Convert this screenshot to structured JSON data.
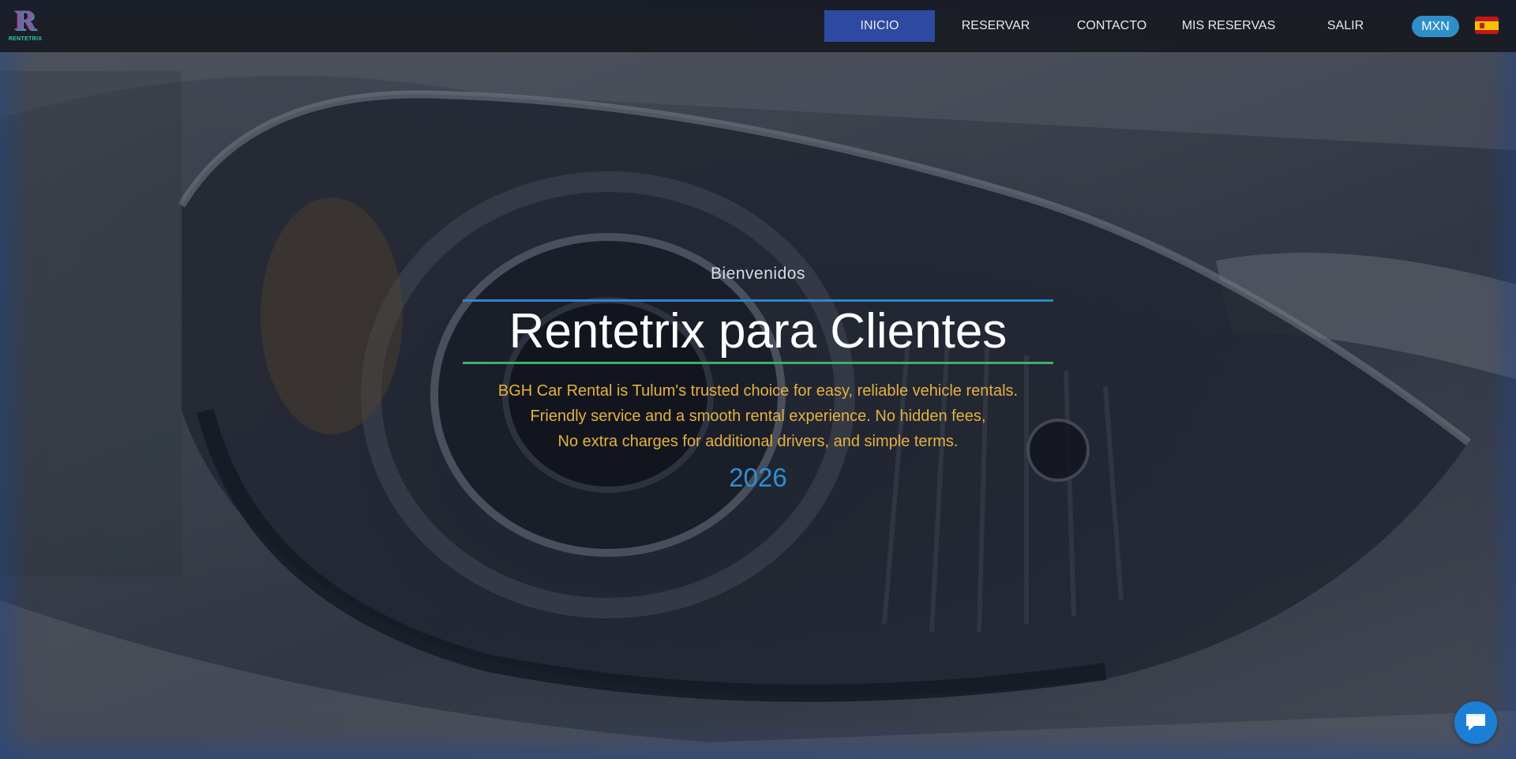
{
  "brand": {
    "logo_letter": "R",
    "logo_text": "RENTETRIX"
  },
  "nav": {
    "items": [
      {
        "label": "INICIO",
        "active": true
      },
      {
        "label": "RESERVAR",
        "active": false
      },
      {
        "label": "CONTACTO",
        "active": false
      },
      {
        "label": "MIS RESERVAS",
        "active": false
      },
      {
        "label": "SALIR",
        "active": false
      }
    ],
    "currency": "MXN",
    "language_icon": "spain-flag-icon"
  },
  "hero": {
    "welcome": "Bienvenidos",
    "title": "Rentetrix para Clientes",
    "description_lines": [
      "BGH Car Rental is Tulum's trusted choice for easy, reliable vehicle rentals.",
      "Friendly service and a smooth rental experience. No hidden fees,",
      "No extra charges for additional drivers, and simple terms."
    ],
    "year": "2026"
  },
  "chat": {
    "icon": "chat-bubble-icon"
  },
  "colors": {
    "nav_active_bg": "#2d4aa0",
    "currency_bg": "#2e8fc9",
    "line_top": "#2f86c8",
    "line_bottom": "#3fae6e",
    "description": "#e6b140",
    "year": "#2f8fd0",
    "chat_button": "#1c7fd6"
  }
}
